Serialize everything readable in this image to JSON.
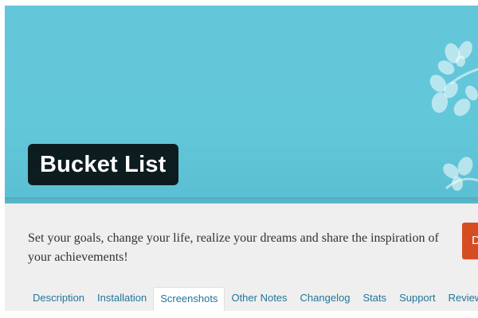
{
  "plugin": {
    "name": "Bucket List",
    "short_description": "Set your goals, change your life, realize your dreams and share the inspiration of your achievements!",
    "download_label": "Download"
  },
  "tabs": [
    {
      "label": "Description",
      "active": false
    },
    {
      "label": "Installation",
      "active": false
    },
    {
      "label": "Screenshots",
      "active": true
    },
    {
      "label": "Other Notes",
      "active": false
    },
    {
      "label": "Changelog",
      "active": false
    },
    {
      "label": "Stats",
      "active": false
    },
    {
      "label": "Support",
      "active": false
    },
    {
      "label": "Reviews",
      "active": false
    }
  ],
  "banner": {
    "background_color": "#63c6d9",
    "decoration_icon": "flower-branch-icon"
  },
  "colors": {
    "title_box": "#1e1e1e",
    "tab_link": "#21759b",
    "download_button": "#d54e21",
    "header_background": "#efefef"
  }
}
